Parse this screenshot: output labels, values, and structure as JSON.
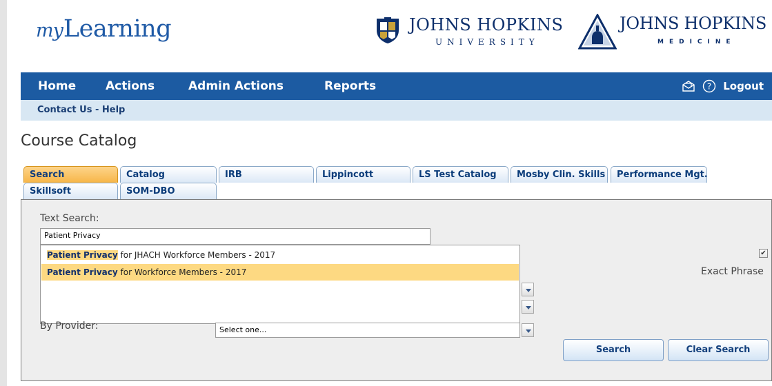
{
  "brand": {
    "logo_prefix": "my",
    "logo_main": "Learning",
    "jhu_name": "JOHNS HOPKINS",
    "jhu_sub": "UNIVERSITY",
    "jhm_name": "JOHNS HOPKINS",
    "jhm_sub": "MEDICINE"
  },
  "nav": {
    "items": [
      "Home",
      "Actions",
      "Admin Actions",
      "Reports"
    ],
    "logout_label": "Logout",
    "icons": [
      "envelope-icon",
      "help-icon"
    ]
  },
  "subnav": {
    "contact": "Contact Us - Help"
  },
  "page": {
    "title": "Course Catalog"
  },
  "tabs": [
    {
      "label": "Search",
      "active": true
    },
    {
      "label": "Catalog"
    },
    {
      "label": "IRB"
    },
    {
      "label": "Lippincott"
    },
    {
      "label": "LS Test Catalog"
    },
    {
      "label": "Mosby Clin. Skills"
    },
    {
      "label": "Performance Mgt."
    },
    {
      "label": "Skillsoft"
    },
    {
      "label": "SOM-DBO"
    }
  ],
  "search": {
    "text_label": "Text Search:",
    "text_value": "Patient Privacy",
    "suggestions": [
      {
        "match": "Patient Privacy",
        "rest": " for JHACH Workforce Members - 2017"
      },
      {
        "match": "Patient Privacy",
        "rest": " for Workforce Members - 2017"
      }
    ],
    "exact_phrase_label": "Exact Phrase",
    "exact_phrase_checked": true,
    "provider_label": "By Provider:",
    "provider_value": "Select one...",
    "search_button": "Search",
    "clear_button": "Clear Search"
  },
  "colors": {
    "nav_bg": "#1c5ba2",
    "subnav_bg": "#d8e7f3",
    "active_tab": "#f7b648",
    "highlight": "#fdd982"
  }
}
